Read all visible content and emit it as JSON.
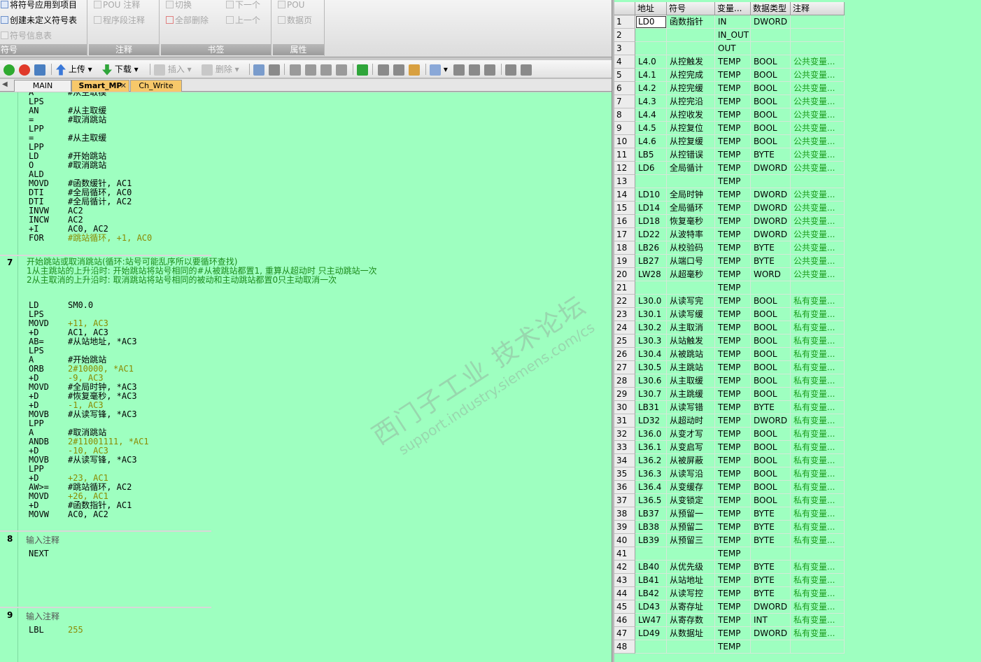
{
  "ribbon": {
    "symbol": {
      "apply": "将符号应用到项目",
      "create": "创建未定义符号表",
      "info": "符号信息表",
      "group": "符号"
    },
    "comment": {
      "pou": "POU 注释",
      "segment": "程序段注释",
      "group": "注释"
    },
    "bookmark": {
      "toggle": "切换",
      "delete_all": "全部删除",
      "next": "下一个",
      "prev": "上一个",
      "group": "书签"
    },
    "property": {
      "pou": "POU",
      "datapage": "数据页",
      "group": "属性"
    }
  },
  "toolbar": {
    "upload": "上传",
    "download": "下载",
    "insert": "插入",
    "delete": "删除"
  },
  "tabs": [
    "MAIN",
    "Smart_MP",
    "Ch_Write"
  ],
  "editor": {
    "block_top": [
      [
        "A",
        "#从主取模"
      ],
      [
        "LPS",
        ""
      ],
      [
        "AN",
        "#从主取缓"
      ],
      [
        "=",
        "#取消跳站"
      ],
      [
        "LPP",
        ""
      ],
      [
        "=",
        "#从主取缓"
      ],
      [
        "LPP",
        ""
      ],
      [
        "LD",
        "#开始跳站"
      ],
      [
        "O",
        "#取消跳站"
      ],
      [
        "ALD",
        ""
      ],
      [
        "MOVD",
        "#函数缓针, AC1"
      ],
      [
        "DTI",
        "#全局循环, AC0"
      ],
      [
        "DTI",
        "#全局循计, AC2"
      ],
      [
        "INVW",
        "AC2"
      ],
      [
        "INCW",
        "AC2"
      ],
      [
        "+I",
        "AC0, AC2"
      ],
      [
        "FOR",
        "#跳站循环, +1, AC0"
      ]
    ],
    "nw7": {
      "num": "7",
      "comment": [
        "开始跳站或取消跳站(循环:站号可能乱序所以要循环查找)",
        "1从主跳站的上升沿时: 开始跳站将站号相同的#从被跳站都置1, 重算从超动时 只主动跳站一次",
        "2从主取消的上升沿时: 取消跳站将站号相同的被动和主动跳站都置0只主动取消一次"
      ],
      "code": [
        [
          "LD",
          "SM0.0"
        ],
        [
          "LPS",
          ""
        ],
        [
          "MOVD",
          "+11, AC3"
        ],
        [
          "+D",
          "AC1, AC3"
        ],
        [
          "AB=",
          "#从站地址, *AC3"
        ],
        [
          "LPS",
          ""
        ],
        [
          "A",
          "#开始跳站"
        ],
        [
          "ORB",
          "2#10000, *AC1"
        ],
        [
          "+D",
          "-9, AC3"
        ],
        [
          "MOVD",
          "#全局时钟, *AC3"
        ],
        [
          "+D",
          "#恢复毫秒, *AC3"
        ],
        [
          "+D",
          "-1, AC3"
        ],
        [
          "MOVB",
          "#从读写锋, *AC3"
        ],
        [
          "LPP",
          ""
        ],
        [
          "A",
          "#取消跳站"
        ],
        [
          "ANDB",
          "2#11001111, *AC1"
        ],
        [
          "+D",
          "-10, AC3"
        ],
        [
          "MOVB",
          "#从读写锋, *AC3"
        ],
        [
          "LPP",
          ""
        ],
        [
          "+D",
          "+23, AC1"
        ],
        [
          "AW>=",
          "#跳站循环, AC2"
        ],
        [
          "MOVD",
          "+26, AC1"
        ],
        [
          "+D",
          "#函数指针, AC1"
        ],
        [
          "MOVW",
          "AC0, AC2"
        ]
      ]
    },
    "nw8": {
      "num": "8",
      "comment": "输入注释",
      "code": [
        [
          "NEXT",
          ""
        ]
      ]
    },
    "nw9": {
      "num": "9",
      "comment": "输入注释",
      "code": [
        [
          "LBL",
          "255"
        ]
      ]
    },
    "watermark": {
      "line1": "西门子工业 技术论坛",
      "line2": "support.industry.siemens.com/cs"
    }
  },
  "symtable": {
    "headers": [
      "地址",
      "符号",
      "变量...",
      "数据类型",
      "注释"
    ],
    "rows": [
      [
        "1",
        "LD0",
        "函数指针",
        "IN",
        "DWORD",
        ""
      ],
      [
        "2",
        "",
        "",
        "IN_OUT",
        "",
        ""
      ],
      [
        "3",
        "",
        "",
        "OUT",
        "",
        ""
      ],
      [
        "4",
        "L4.0",
        "从控触发",
        "TEMP",
        "BOOL",
        "公共变量..."
      ],
      [
        "5",
        "L4.1",
        "从控完成",
        "TEMP",
        "BOOL",
        "公共变量..."
      ],
      [
        "6",
        "L4.2",
        "从控完缓",
        "TEMP",
        "BOOL",
        "公共变量..."
      ],
      [
        "7",
        "L4.3",
        "从控完沿",
        "TEMP",
        "BOOL",
        "公共变量..."
      ],
      [
        "8",
        "L4.4",
        "从控收发",
        "TEMP",
        "BOOL",
        "公共变量..."
      ],
      [
        "9",
        "L4.5",
        "从控复位",
        "TEMP",
        "BOOL",
        "公共变量..."
      ],
      [
        "10",
        "L4.6",
        "从控复缓",
        "TEMP",
        "BOOL",
        "公共变量..."
      ],
      [
        "11",
        "LB5",
        "从控错误",
        "TEMP",
        "BYTE",
        "公共变量..."
      ],
      [
        "12",
        "LD6",
        "全局循计",
        "TEMP",
        "DWORD",
        "公共变量..."
      ],
      [
        "13",
        "",
        "",
        "TEMP",
        "",
        ""
      ],
      [
        "14",
        "LD10",
        "全局时钟",
        "TEMP",
        "DWORD",
        "公共变量..."
      ],
      [
        "15",
        "LD14",
        "全局循环",
        "TEMP",
        "DWORD",
        "公共变量..."
      ],
      [
        "16",
        "LD18",
        "恢复毫秒",
        "TEMP",
        "DWORD",
        "公共变量..."
      ],
      [
        "17",
        "LD22",
        "从波特率",
        "TEMP",
        "DWORD",
        "公共变量..."
      ],
      [
        "18",
        "LB26",
        "从校验码",
        "TEMP",
        "BYTE",
        "公共变量..."
      ],
      [
        "19",
        "LB27",
        "从端口号",
        "TEMP",
        "BYTE",
        "公共变量..."
      ],
      [
        "20",
        "LW28",
        "从超毫秒",
        "TEMP",
        "WORD",
        "公共变量..."
      ],
      [
        "21",
        "",
        "",
        "TEMP",
        "",
        ""
      ],
      [
        "22",
        "L30.0",
        "从读写完",
        "TEMP",
        "BOOL",
        "私有变量..."
      ],
      [
        "23",
        "L30.1",
        "从读写缓",
        "TEMP",
        "BOOL",
        "私有变量..."
      ],
      [
        "24",
        "L30.2",
        "从主取消",
        "TEMP",
        "BOOL",
        "私有变量..."
      ],
      [
        "25",
        "L30.3",
        "从站触发",
        "TEMP",
        "BOOL",
        "私有变量..."
      ],
      [
        "26",
        "L30.4",
        "从被跳站",
        "TEMP",
        "BOOL",
        "私有变量..."
      ],
      [
        "27",
        "L30.5",
        "从主跳站",
        "TEMP",
        "BOOL",
        "私有变量..."
      ],
      [
        "28",
        "L30.6",
        "从主取缓",
        "TEMP",
        "BOOL",
        "私有变量..."
      ],
      [
        "29",
        "L30.7",
        "从主跳缓",
        "TEMP",
        "BOOL",
        "私有变量..."
      ],
      [
        "30",
        "LB31",
        "从读写错",
        "TEMP",
        "BYTE",
        "私有变量..."
      ],
      [
        "31",
        "LD32",
        "从超动时",
        "TEMP",
        "DWORD",
        "私有变量..."
      ],
      [
        "32",
        "L36.0",
        "从变才写",
        "TEMP",
        "BOOL",
        "私有变量..."
      ],
      [
        "33",
        "L36.1",
        "从变启写",
        "TEMP",
        "BOOL",
        "私有变量..."
      ],
      [
        "34",
        "L36.2",
        "从被屏蔽",
        "TEMP",
        "BOOL",
        "私有变量..."
      ],
      [
        "35",
        "L36.3",
        "从读写沿",
        "TEMP",
        "BOOL",
        "私有变量..."
      ],
      [
        "36",
        "L36.4",
        "从变缓存",
        "TEMP",
        "BOOL",
        "私有变量..."
      ],
      [
        "37",
        "L36.5",
        "从变锁定",
        "TEMP",
        "BOOL",
        "私有变量..."
      ],
      [
        "38",
        "LB37",
        "从预留一",
        "TEMP",
        "BYTE",
        "私有变量..."
      ],
      [
        "39",
        "LB38",
        "从预留二",
        "TEMP",
        "BYTE",
        "私有变量..."
      ],
      [
        "40",
        "LB39",
        "从预留三",
        "TEMP",
        "BYTE",
        "私有变量..."
      ],
      [
        "41",
        "",
        "",
        "TEMP",
        "",
        ""
      ],
      [
        "42",
        "LB40",
        "从优先级",
        "TEMP",
        "BYTE",
        "私有变量..."
      ],
      [
        "43",
        "LB41",
        "从站地址",
        "TEMP",
        "BYTE",
        "私有变量..."
      ],
      [
        "44",
        "LB42",
        "从读写控",
        "TEMP",
        "BYTE",
        "私有变量..."
      ],
      [
        "45",
        "LD43",
        "从寄存址",
        "TEMP",
        "DWORD",
        "私有变量..."
      ],
      [
        "46",
        "LW47",
        "从寄存数",
        "TEMP",
        "INT",
        "私有变量..."
      ],
      [
        "47",
        "LD49",
        "从数据址",
        "TEMP",
        "DWORD",
        "私有变量..."
      ],
      [
        "48",
        "",
        "",
        "TEMP",
        "",
        ""
      ]
    ]
  },
  "colors": {
    "editor_bg": "#9effc0",
    "comment_green": "#1b9a1b",
    "tab_active": "#f7c86a"
  }
}
